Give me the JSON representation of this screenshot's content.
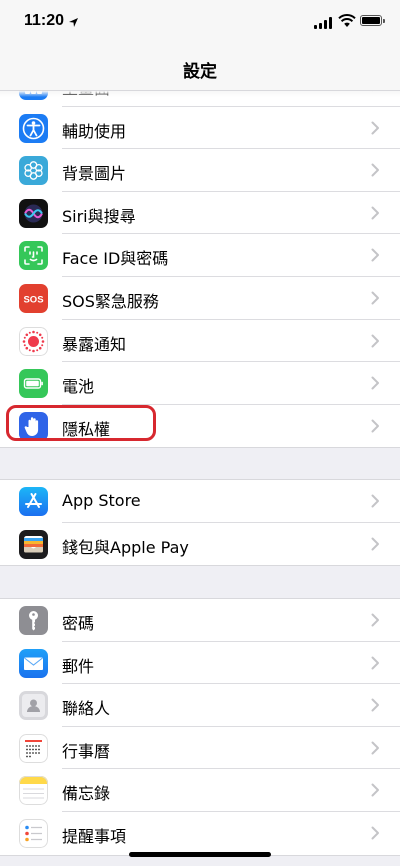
{
  "status": {
    "time": "11:20",
    "location_icon": "location-arrow-icon",
    "battery_level": 1.0
  },
  "nav": {
    "title": "設定"
  },
  "group1": [
    {
      "label": "主畫面",
      "icon": "home-screen-icon",
      "color": "#1c7cf4"
    },
    {
      "label": "輔助使用",
      "icon": "accessibility-icon",
      "color": "#1c7cf4"
    },
    {
      "label": "背景圖片",
      "icon": "wallpaper-icon",
      "color": "#3aa9d9"
    },
    {
      "label": "Siri與搜尋",
      "icon": "siri-icon",
      "color": "#1a1a2e"
    },
    {
      "label": "Face ID與密碼",
      "icon": "face-id-icon",
      "color": "#35c759"
    },
    {
      "label": "SOS緊急服務",
      "icon": "sos-icon",
      "color": "#e2402f",
      "badge": "SOS"
    },
    {
      "label": "暴露通知",
      "icon": "exposure-notification-icon",
      "color": "#ffffff"
    },
    {
      "label": "電池",
      "icon": "battery-icon",
      "color": "#35c759"
    },
    {
      "label": "隱私權",
      "icon": "privacy-hand-icon",
      "color": "#2f64e8"
    }
  ],
  "group2": [
    {
      "label": "App Store",
      "icon": "app-store-icon",
      "color": "#1c8cf4"
    },
    {
      "label": "錢包與Apple Pay",
      "icon": "wallet-icon",
      "color": "#1c1c1e"
    }
  ],
  "group3": [
    {
      "label": "密碼",
      "icon": "key-icon",
      "color": "#8e8e93"
    },
    {
      "label": "郵件",
      "icon": "mail-icon",
      "color": "#2a8cf4"
    },
    {
      "label": "聯絡人",
      "icon": "contacts-icon",
      "color": "#c9c9cd"
    },
    {
      "label": "行事曆",
      "icon": "calendar-icon",
      "color": "#ffffff"
    },
    {
      "label": "備忘錄",
      "icon": "notes-icon",
      "color": "#ffd94a"
    },
    {
      "label": "提醒事項",
      "icon": "reminders-icon",
      "color": "#ffffff"
    }
  ],
  "colors": {
    "highlight": "#d7282f",
    "chevron": "#c4c4c7",
    "background": "#efeff4"
  }
}
